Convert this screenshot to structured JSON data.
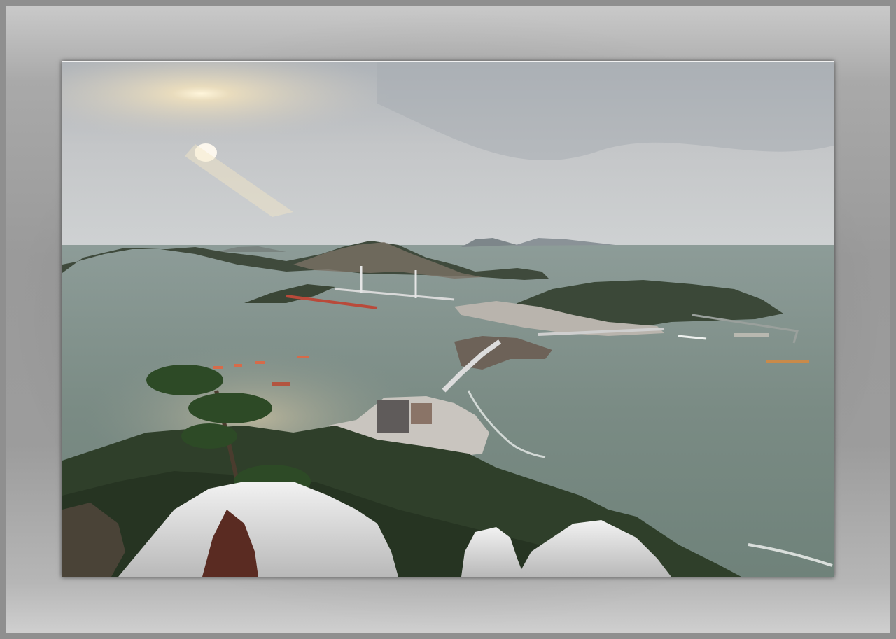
{
  "photo": {
    "subject": "coastal-landscape",
    "colors": {
      "frame": "#8f8f8f",
      "mat": "#a9a9a9",
      "sky": "#c2c6ca",
      "sea": "#7d8d86",
      "forest": "#2f3f2a"
    }
  }
}
